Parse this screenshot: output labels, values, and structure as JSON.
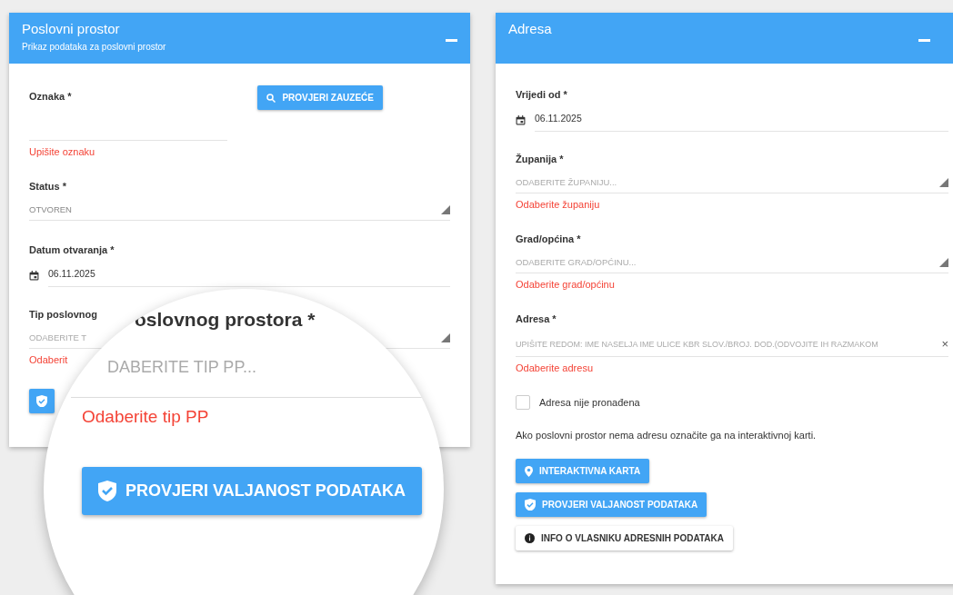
{
  "panels": [
    {
      "title": "Poslovni prostor",
      "subtitle": "Prikaz podataka za poslovni prostor",
      "fields": [
        {
          "kind": "text",
          "label": "Oznaka *",
          "error": "Upišite oznaku",
          "button": "PROVJERI ZAUZEĆE"
        },
        {
          "kind": "select",
          "label": "Status *",
          "value": "OTVOREN"
        },
        {
          "kind": "date",
          "label": "Datum otvaranja *",
          "value": "06.11.2025"
        },
        {
          "kind": "select",
          "label": "Tip poslovnog",
          "placeholder": "ODABERITE T",
          "error": "Odaberit"
        },
        {
          "kind": "validate"
        }
      ]
    },
    {
      "title": "Adresa",
      "fields": [
        {
          "kind": "date",
          "label": "Vrijedi od *",
          "value": "06.11.2025"
        },
        {
          "kind": "select",
          "label": "Županija *",
          "placeholder": "ODABERITE ŽUPANIJU...",
          "error": "Odaberite županiju"
        },
        {
          "kind": "select",
          "label": "Grad/općina *",
          "placeholder": "ODABERITE GRAD/OPĆINU...",
          "error": "Odaberite grad/općinu"
        },
        {
          "kind": "address",
          "label": "Adresa *",
          "placeholder": "UPIŠITE REDOM: IME NASELJA IME ULICE KBR SLOV./BROJ. DOD.(ODVOJITE IH RAZMAKOM",
          "clear": "×",
          "error": "Odaberite adresu"
        },
        {
          "kind": "checkbox",
          "label": "Adresa nije pronađena",
          "checked": false
        },
        {
          "kind": "note",
          "text": "Ako poslovni prostor nema adresu označite ga na interaktivnoj karti."
        },
        {
          "kind": "map",
          "label": "INTERAKTIVNA KARTA"
        },
        {
          "kind": "validate",
          "label": "PROVJERI VALJANOST PODATAKA"
        },
        {
          "kind": "info",
          "label": "INFO O VLASNIKU ADRESNIH PODATAKA"
        }
      ]
    }
  ],
  "magnifier": {
    "label": "oslovnog prostora *",
    "placeholder": "DABERITE TIP PP...",
    "error": "Odaberite tip PP",
    "button": "PROVJERI VALJANOST PODATAKA"
  }
}
